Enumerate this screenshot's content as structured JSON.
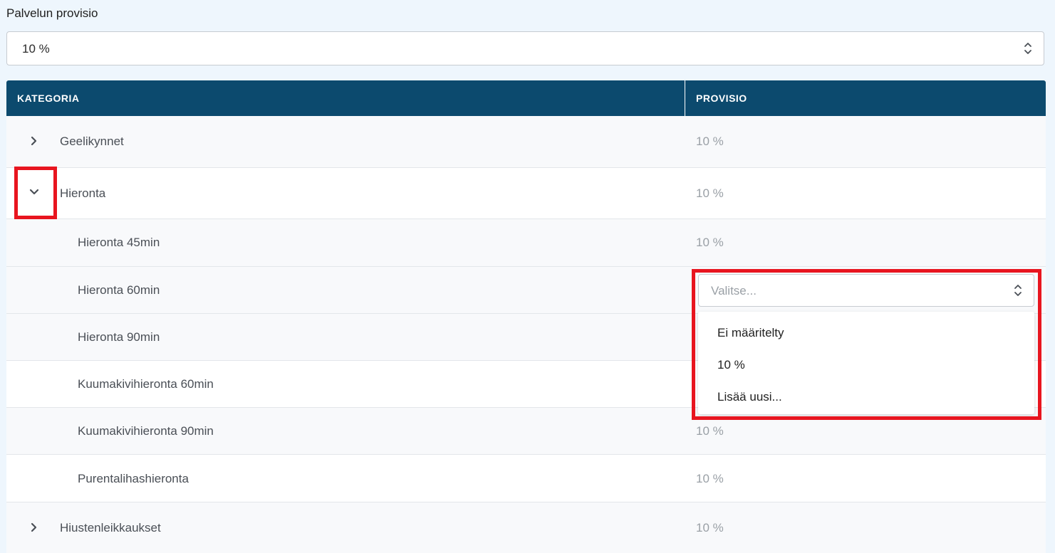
{
  "form": {
    "label": "Palvelun provisio",
    "selected": "10 %"
  },
  "table": {
    "headers": [
      "KATEGORIA",
      "PROVISIO"
    ],
    "rows": [
      {
        "name": "Geelikynnet",
        "provision": "10 %",
        "level": 0,
        "expander": "collapsed"
      },
      {
        "name": "Hieronta",
        "provision": "10 %",
        "level": 0,
        "expander": "expanded"
      },
      {
        "name": "Hieronta 45min",
        "provision": "10 %",
        "level": 1
      },
      {
        "name": "Hieronta 60min",
        "provision": "",
        "level": 1
      },
      {
        "name": "Hieronta 90min",
        "provision": "",
        "level": 1
      },
      {
        "name": "Kuumakivihieronta 60min",
        "provision": "",
        "level": 1
      },
      {
        "name": "Kuumakivihieronta 90min",
        "provision": "10 %",
        "level": 1
      },
      {
        "name": "Purentalihashieronta",
        "provision": "10 %",
        "level": 1
      },
      {
        "name": "Hiustenleikkaukset",
        "provision": "10 %",
        "level": 0,
        "expander": "collapsed"
      }
    ]
  },
  "inline_select": {
    "placeholder": "Valitse...",
    "options": [
      "Ei määritelty",
      "10 %",
      "Lisää uusi..."
    ]
  },
  "colors": {
    "header_bg": "#0c4a6e",
    "highlight": "#e8151f",
    "page_bg": "#eef6fd"
  },
  "icons": {
    "collapsed": "chevron-right-icon",
    "expanded": "chevron-down-icon",
    "select": "chevron-up-down-icon"
  }
}
